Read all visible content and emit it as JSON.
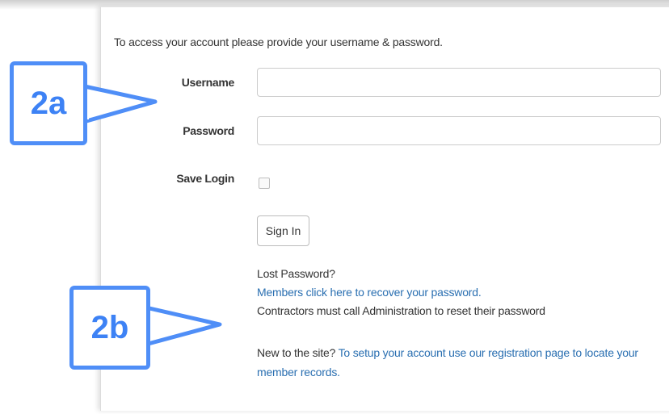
{
  "form": {
    "intro_text": "To access your account please provide your username & password.",
    "username_label": "Username",
    "username_value": "",
    "password_label": "Password",
    "password_value": "",
    "save_login_label": "Save Login",
    "save_login_checked": false,
    "signin_label": "Sign In"
  },
  "help": {
    "lost_password": "Lost Password?",
    "recover_link": "Members click here to recover your password.",
    "contractors_note": "Contractors must call Administration to reset their password",
    "new_to_site": "New to the site?",
    "registration_link_line1": "To setup your account use our registration page to locate your",
    "registration_link_line2": "member records."
  },
  "annotations": {
    "callout_a": "2a",
    "callout_b": "2b",
    "callout_color": "#4f8ef7"
  },
  "colors": {
    "link": "#2a6fb1",
    "text": "#333333"
  }
}
